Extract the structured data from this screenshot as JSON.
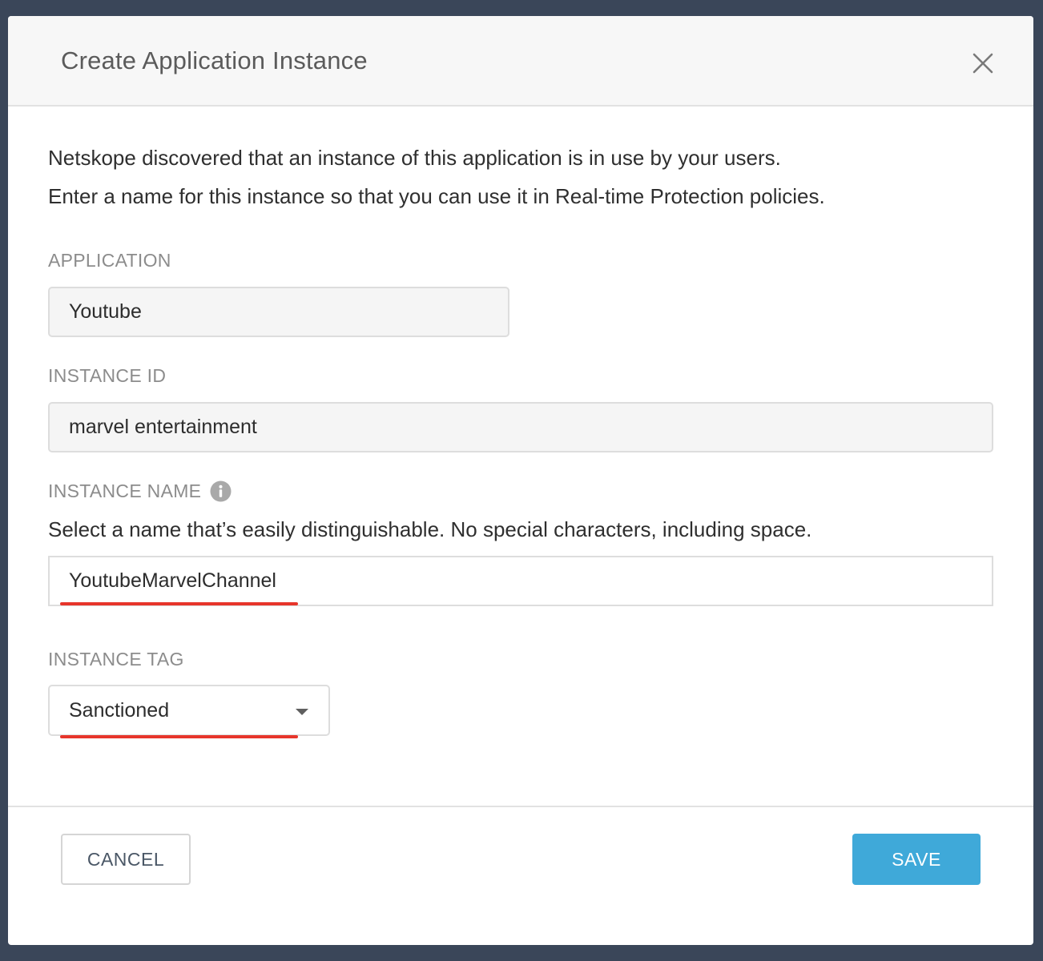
{
  "modal": {
    "title": "Create Application Instance",
    "close_icon": "close-icon"
  },
  "intro": {
    "line1": "Netskope discovered that an instance of this application is in use by your users.",
    "line2": "Enter a name for this instance so that you can use it in Real-time Protection policies."
  },
  "fields": {
    "application": {
      "label": "APPLICATION",
      "value": "Youtube"
    },
    "instance_id": {
      "label": "INSTANCE ID",
      "value": "marvel entertainment"
    },
    "instance_name": {
      "label": "INSTANCE NAME",
      "info_icon": "info-icon",
      "hint": "Select a name that’s easily distinguishable. No special characters, including space.",
      "value": "YoutubeMarvelChannel"
    },
    "instance_tag": {
      "label": "INSTANCE TAG",
      "selected": "Sanctioned"
    }
  },
  "buttons": {
    "cancel": "CANCEL",
    "save": "SAVE"
  },
  "colors": {
    "backdrop": "#3a4659",
    "accent": "#3fa9d9",
    "annotation_underline": "#e7352b"
  }
}
